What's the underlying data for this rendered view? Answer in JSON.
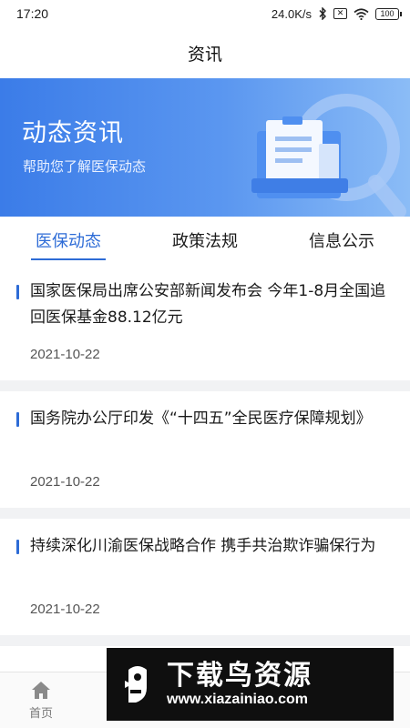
{
  "status_bar": {
    "time": "17:20",
    "speed": "24.0K/s",
    "battery": "100"
  },
  "nav": {
    "title": "资讯"
  },
  "banner": {
    "title": "动态资讯",
    "subtitle": "帮助您了解医保动态"
  },
  "tabs": [
    {
      "label": "医保动态",
      "active": true
    },
    {
      "label": "政策法规",
      "active": false
    },
    {
      "label": "信息公示",
      "active": false
    }
  ],
  "news": [
    {
      "title": "国家医保局出席公安部新闻发布会 今年1-8月全国追回医保基金88.12亿元",
      "date": "2021-10-22"
    },
    {
      "title": "国务院办公厅印发《“十四五”全民医疗保障规划》",
      "date": "2021-10-22"
    },
    {
      "title": "持续深化川渝医保战略合作 携手共治欺诈骗保行为",
      "date": "2021-10-22"
    }
  ],
  "tabbar": {
    "home_label": "首页"
  },
  "watermark": {
    "name": "下载鸟资源",
    "url": "www.xiazainiao.com"
  },
  "colors": {
    "accent": "#2d6bd6",
    "banner": "#4a87ec"
  }
}
